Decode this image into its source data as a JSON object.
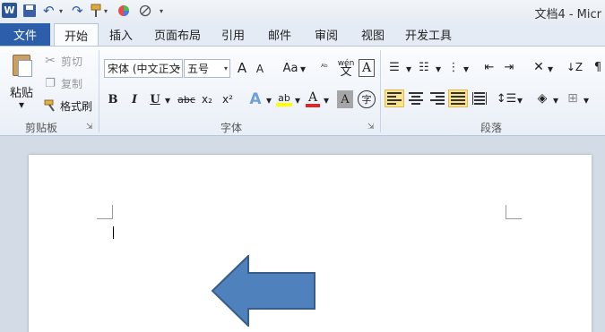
{
  "titlebar": {
    "app_logo": "W",
    "title": "文档4 - Micr",
    "icons": [
      "word-logo-icon",
      "save-icon",
      "undo-icon",
      "redo-icon",
      "format-painter-icon",
      "color-wheel-icon",
      "no-symbol-icon",
      "customize-qat-icon"
    ]
  },
  "tabs": {
    "file": "文件",
    "items": [
      "开始",
      "插入",
      "页面布局",
      "引用",
      "邮件",
      "审阅",
      "视图",
      "开发工具"
    ],
    "active_index": 0
  },
  "clipboard": {
    "paste": "粘贴",
    "cut": "剪切",
    "copy": "复制",
    "format_painter": "格式刷",
    "group_label": "剪贴板"
  },
  "font": {
    "font_name": "宋体 (中文正文",
    "font_size": "五号",
    "grow": "A",
    "shrink": "A",
    "change_case": "Aa",
    "bold": "B",
    "italic": "I",
    "underline": "U",
    "strikethrough": "abc",
    "subscript": "x₂",
    "superscript": "x²",
    "text_effects": "A",
    "highlight": "ab",
    "font_color": "A",
    "char_shading": "A",
    "enclose": "字",
    "phonetic": "wén",
    "clear_format": "A",
    "group_label": "字体"
  },
  "paragraph": {
    "group_label": "段落"
  },
  "colors": {
    "accent": "#2c5eab",
    "highlight_yellow": "#fbe28f",
    "font_red": "#d62b2b",
    "arrow_fill": "#4f81bd",
    "arrow_stroke": "#385d8a"
  }
}
